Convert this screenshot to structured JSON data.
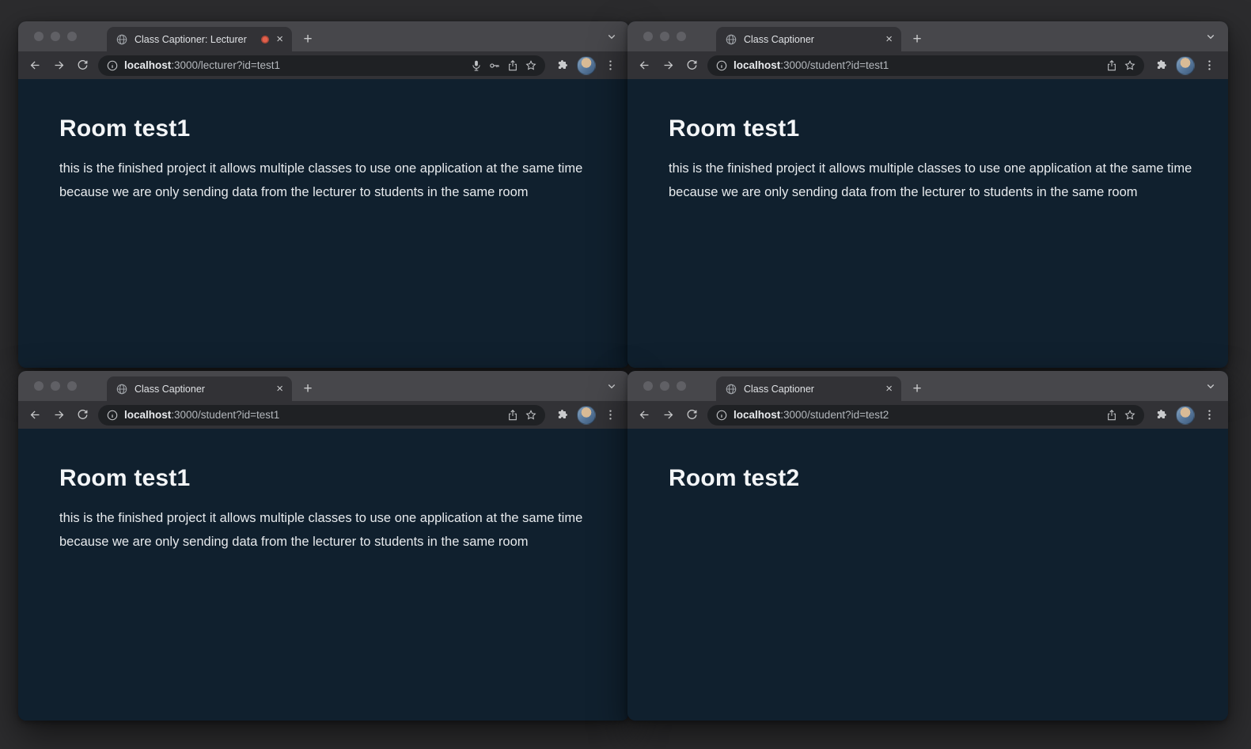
{
  "chrome": {
    "new_tab_label": "+",
    "close_tab_label": "×"
  },
  "colors": {
    "desktop_background": "#2c2c2e",
    "tab_strip": "#47474b",
    "toolbar": "#323236",
    "url_bar": "#1f2124",
    "page_background": "#10202e",
    "recording_dot": "#e2604c"
  },
  "windows": [
    {
      "position": "top-left",
      "tab": {
        "title": "Class Captioner: Lecturer",
        "recording": true
      },
      "url": {
        "host": "localhost",
        "rest": ":3000/lecturer?id=test1"
      },
      "url_bar_icons": [
        "mic-icon",
        "key-icon",
        "share-icon",
        "bookmark-star-icon"
      ],
      "page": {
        "heading": "Room test1",
        "body": "this is the finished project it allows multiple classes to use one application at the same time because we are only sending data from the lecturer to students in the same room"
      }
    },
    {
      "position": "top-right",
      "tab": {
        "title": "Class Captioner",
        "recording": false
      },
      "url": {
        "host": "localhost",
        "rest": ":3000/student?id=test1"
      },
      "url_bar_icons": [
        "share-icon",
        "bookmark-star-icon"
      ],
      "page": {
        "heading": "Room test1",
        "body": "this is the finished project it allows multiple classes to use one application at the same time because we are only sending data from the lecturer to students in the same room"
      }
    },
    {
      "position": "bottom-left",
      "tab": {
        "title": "Class Captioner",
        "recording": false
      },
      "url": {
        "host": "localhost",
        "rest": ":3000/student?id=test1"
      },
      "url_bar_icons": [
        "share-icon",
        "bookmark-star-icon"
      ],
      "page": {
        "heading": "Room test1",
        "body": "this is the finished project it allows multiple classes to use one application at the same time because we are only sending data from the lecturer to students in the same room"
      }
    },
    {
      "position": "bottom-right",
      "tab": {
        "title": "Class Captioner",
        "recording": false
      },
      "url": {
        "host": "localhost",
        "rest": ":3000/student?id=test2"
      },
      "url_bar_icons": [
        "share-icon",
        "bookmark-star-icon"
      ],
      "page": {
        "heading": "Room test2",
        "body": ""
      }
    }
  ]
}
